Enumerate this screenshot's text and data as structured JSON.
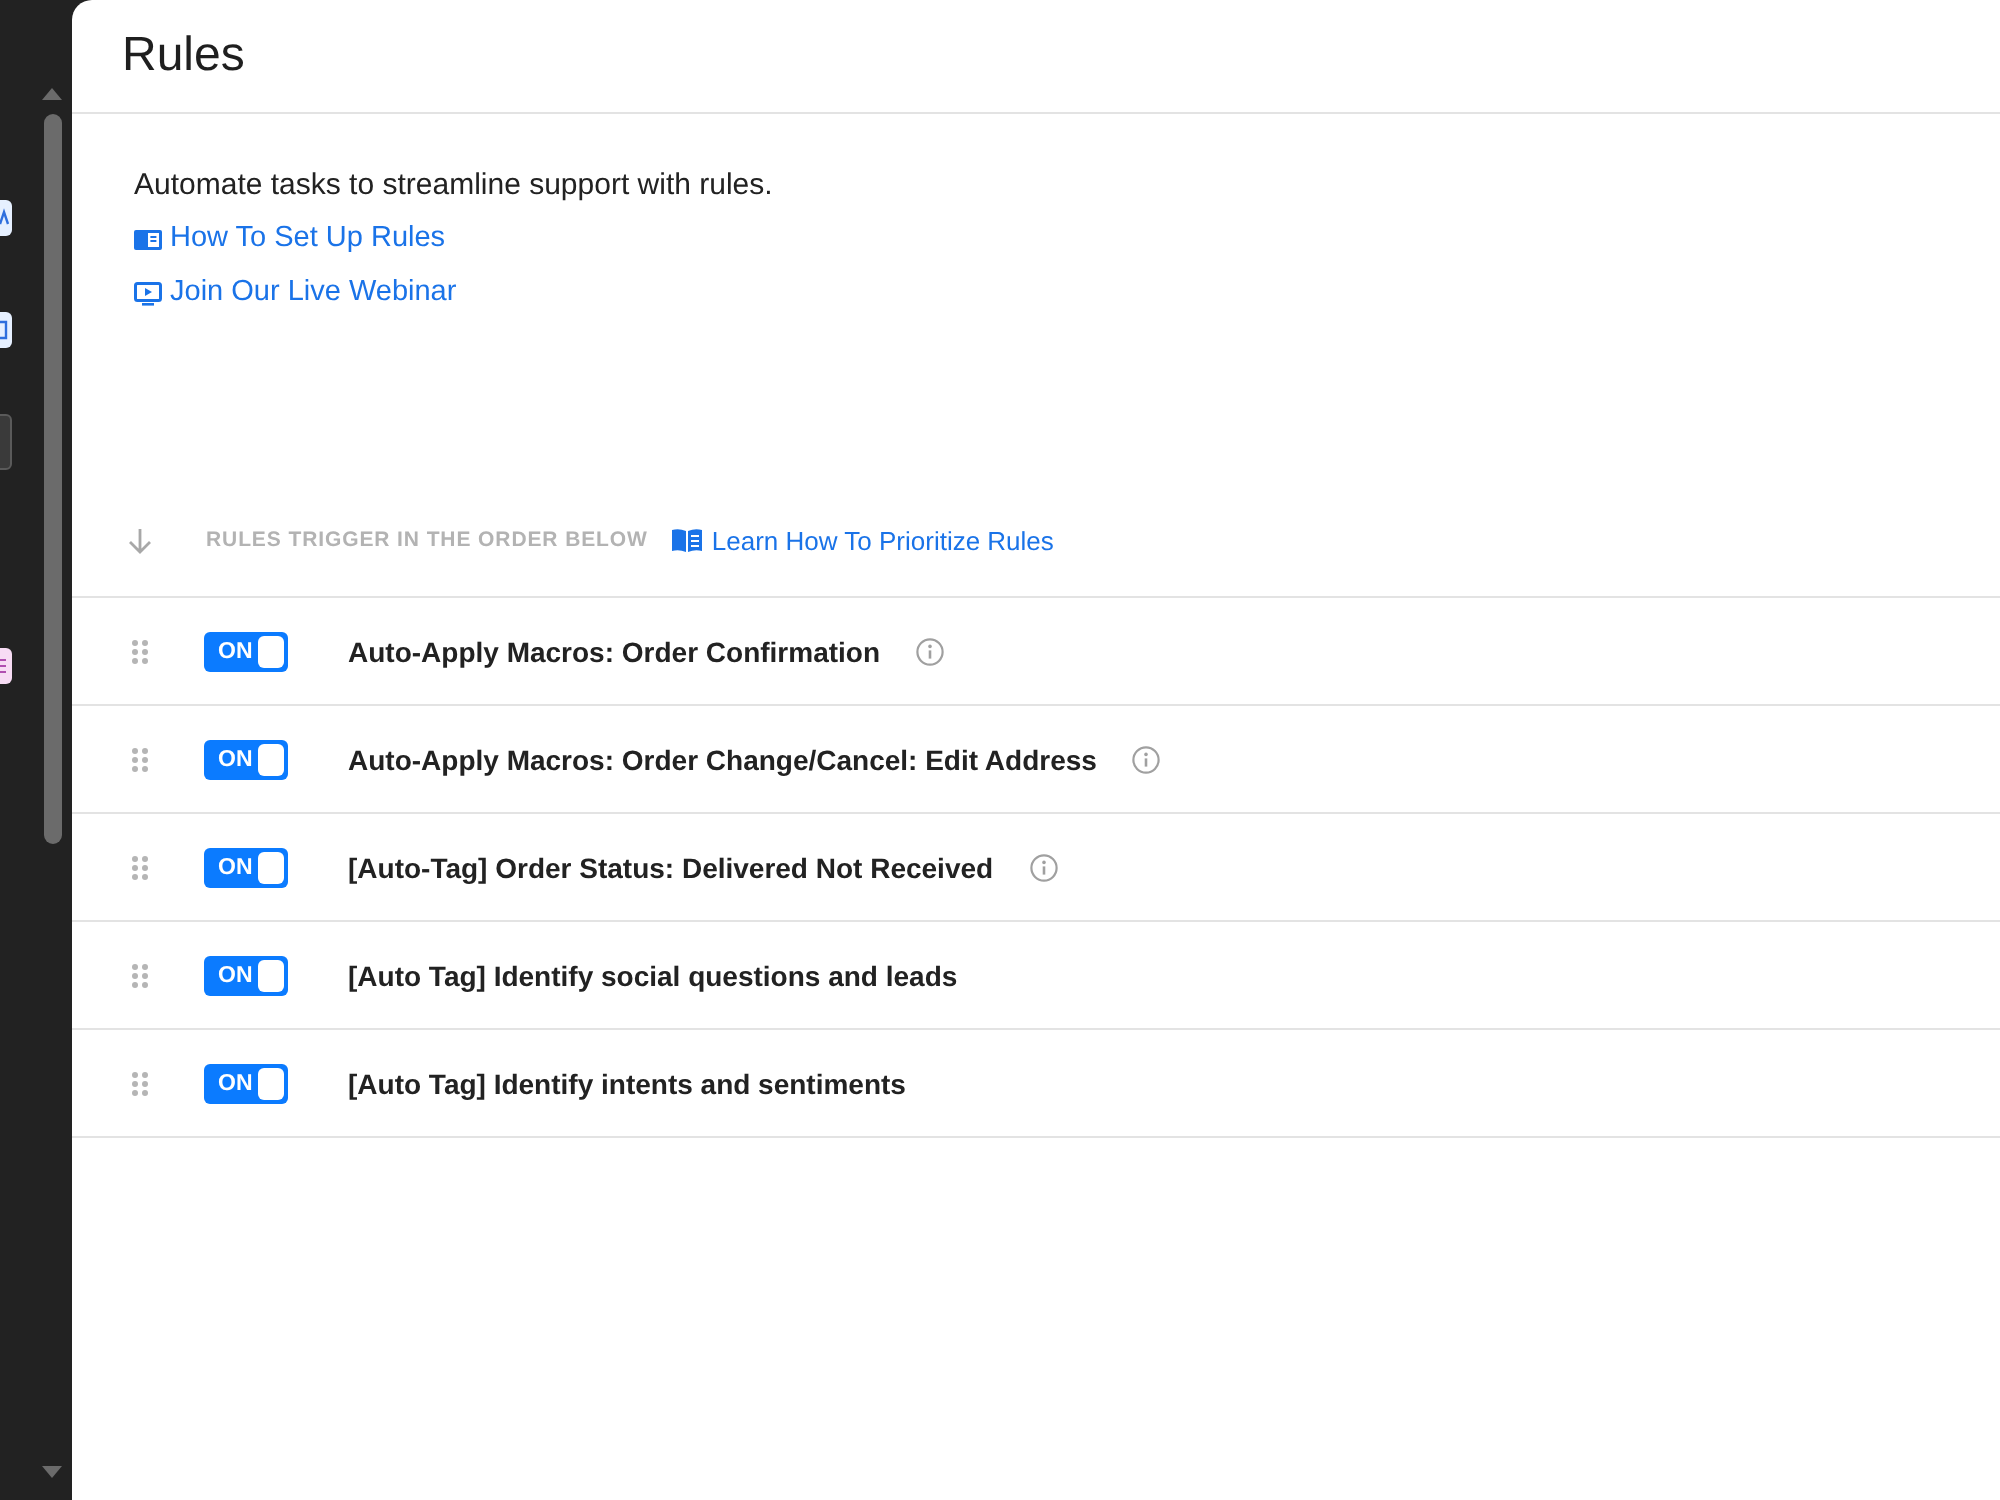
{
  "page": {
    "title": "Rules"
  },
  "intro": {
    "description": "Automate tasks to streamline support with rules.",
    "links": [
      {
        "kind": "guide",
        "label": "How To Set Up Rules"
      },
      {
        "kind": "video",
        "label": "Join Our Live Webinar"
      }
    ]
  },
  "order_bar": {
    "label": "RULES TRIGGER IN THE ORDER BELOW",
    "link": {
      "label": "Learn How To Prioritize Rules"
    }
  },
  "rules": [
    {
      "title": "Auto-Apply Macros: Order Confirmation",
      "toggle_label": "ON",
      "on": true,
      "info": true
    },
    {
      "title": "Auto-Apply Macros: Order Change/Cancel: Edit Address",
      "toggle_label": "ON",
      "on": true,
      "info": true
    },
    {
      "title": "[Auto-Tag] Order Status: Delivered Not Received",
      "toggle_label": "ON",
      "on": true,
      "info": true
    },
    {
      "title": "[Auto Tag] Identify social questions and leads",
      "toggle_label": "ON",
      "on": true,
      "info": false
    },
    {
      "title": "[Auto Tag] Identify intents and sentiments",
      "toggle_label": "ON",
      "on": true,
      "info": false
    }
  ]
}
